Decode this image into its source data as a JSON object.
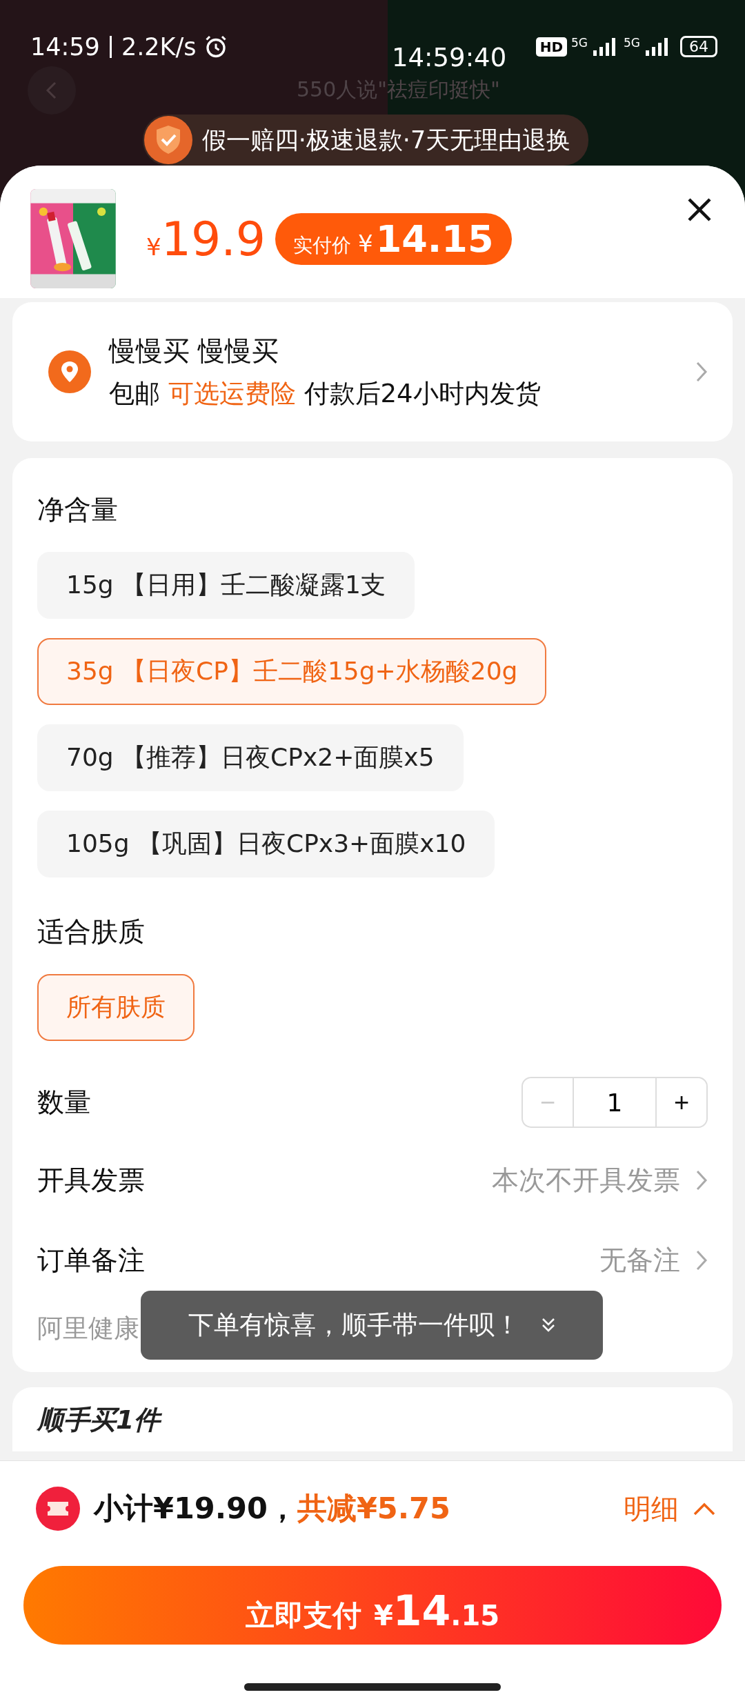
{
  "status_bar": {
    "time": "14:59",
    "speed": "2.2K/s",
    "clock": "14:59:40",
    "hd": "HD",
    "network_1": "5G",
    "network_2": "5G",
    "battery": "64"
  },
  "background": {
    "review": "550人说\"祛痘印挺快\"",
    "guarantee": "假一赔四·极速退款·7天无理由退换"
  },
  "product": {
    "currency": "¥",
    "price": "19.9",
    "pay_label": "实付价",
    "pay_currency": "¥",
    "pay_price": "14.15"
  },
  "address": {
    "name": "慢慢买 慢慢买",
    "shipping": "包邮",
    "insurance": "可选运费险",
    "delivery": "付款后24小时内发货"
  },
  "spec_groups": [
    {
      "title": "净含量",
      "options": [
        {
          "label": "15g 【日用】壬二酸凝露1支",
          "selected": false
        },
        {
          "label": "35g 【日夜CP】壬二酸15g+水杨酸20g",
          "selected": true
        },
        {
          "label": "70g 【推荐】日夜CPx2+面膜x5",
          "selected": false
        },
        {
          "label": "105g 【巩固】日夜CPx3+面膜x10",
          "selected": false
        }
      ]
    },
    {
      "title": "适合肤质",
      "options": [
        {
          "label": "所有肤质",
          "selected": true
        }
      ]
    }
  ],
  "quantity": {
    "label": "数量",
    "minus": "−",
    "value": "1",
    "plus": "+",
    "minus_disabled": true
  },
  "rows": [
    {
      "label": "开具发票",
      "value": "本次不开具发票"
    },
    {
      "label": "订单备注",
      "value": "无备注"
    }
  ],
  "supplier": "阿里健康",
  "toast": "下单有惊喜，顺手带一件呗！",
  "addon_title": "顺手买1件",
  "summary": {
    "subtotal": "小计¥19.90，",
    "discount": "共减¥5.75",
    "detail": "明细"
  },
  "pay_button": {
    "label": "立即支付",
    "currency": "¥",
    "integer": "14",
    "decimal": ".15"
  }
}
